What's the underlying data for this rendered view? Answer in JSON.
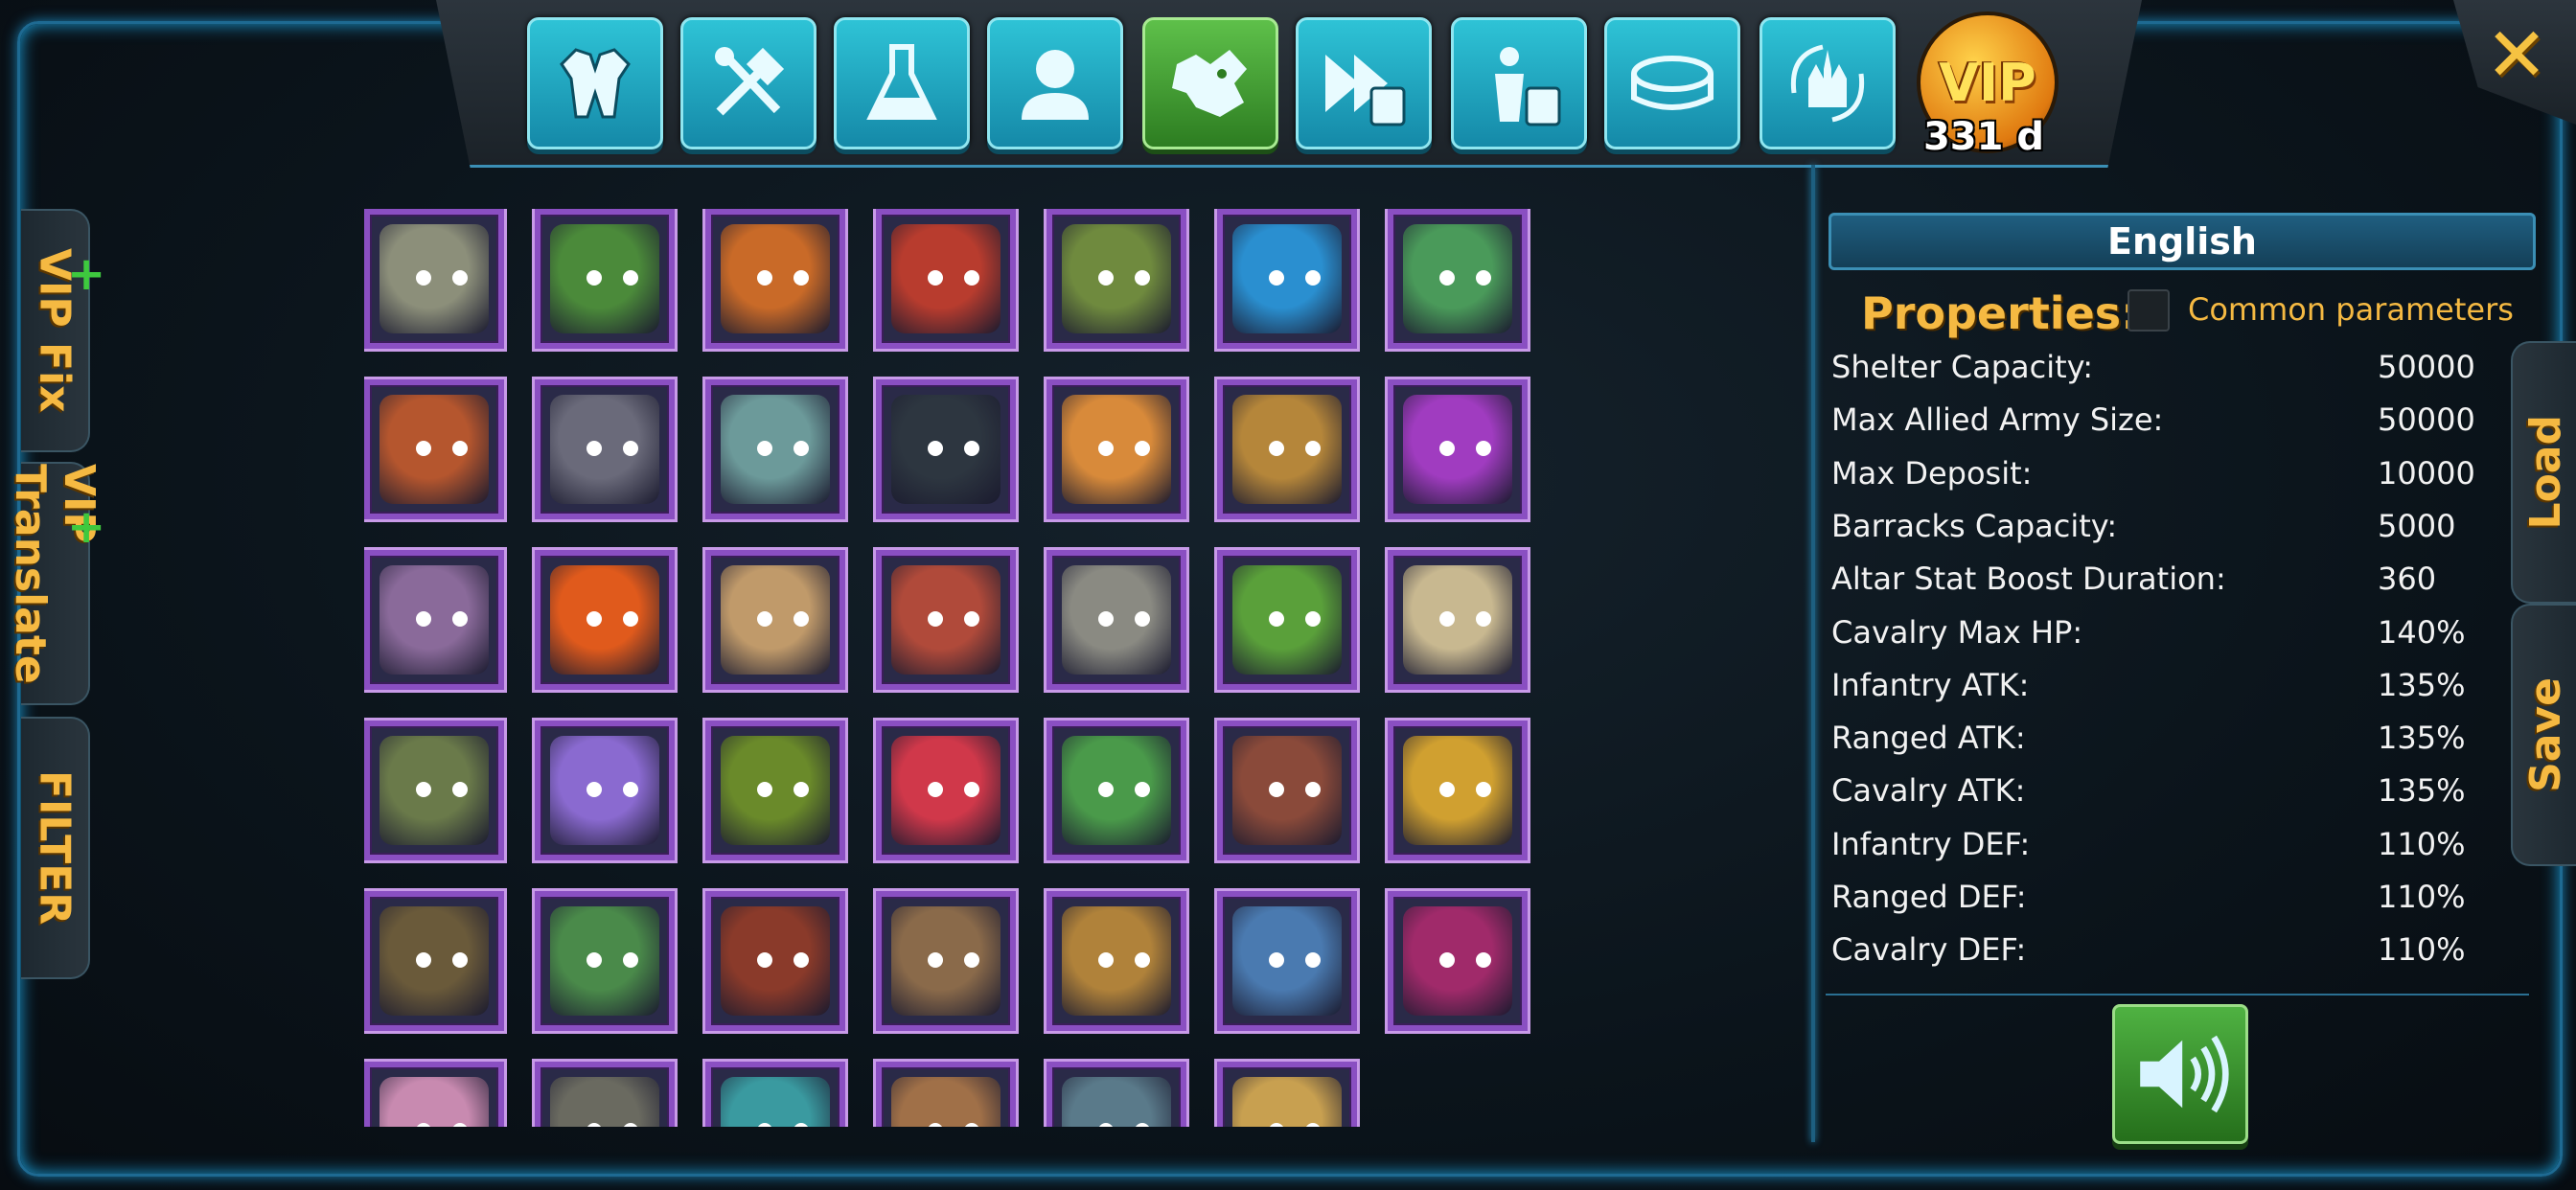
{
  "toolbar": {
    "buttons": [
      {
        "icon": "armor-icon",
        "active": false
      },
      {
        "icon": "tools-icon",
        "active": false
      },
      {
        "icon": "flask-icon",
        "active": false
      },
      {
        "icon": "person-icon",
        "active": false
      },
      {
        "icon": "beast-head-icon",
        "active": true
      },
      {
        "icon": "fast-forward-calculator-icon",
        "active": false
      },
      {
        "icon": "warrior-calculator-icon",
        "active": false
      },
      {
        "icon": "arena-icon",
        "active": false
      },
      {
        "icon": "castle-swap-icon",
        "active": false
      }
    ],
    "vip_label": "VIP",
    "vip_days": "331 d",
    "close_symbol": "✕"
  },
  "left_tabs": {
    "fix_label": "Fix",
    "fix_vip": "VIP",
    "translate_label": "Translate",
    "translate_vip": "VIP",
    "filter_label": "FILTER"
  },
  "right_tabs": {
    "load_label": "Load",
    "save_label": "Save"
  },
  "heroes": {
    "colors": [
      "#8c8f7a",
      "#4b8a3a",
      "#c96a28",
      "#b83c2e",
      "#6f8a3e",
      "#2a8fd0",
      "#4a9a5a",
      "#b5562e",
      "#6a6a7a",
      "#6c9a9a",
      "#2d3640",
      "#d88a3a",
      "#b5863a",
      "#a03cc0",
      "#8a6a9a",
      "#e05a1c",
      "#c09a6a",
      "#b04a3a",
      "#8a8a82",
      "#5aa03a",
      "#c8b890",
      "#6a7a4a",
      "#8a6ad0",
      "#6a8a2a",
      "#d0384a",
      "#4a9a4a",
      "#8a4a3a",
      "#d0a030",
      "#6a5a3a",
      "#4a8a4a",
      "#8a3a2a",
      "#8a6a4a",
      "#b0823a",
      "#4a7ab0",
      "#a02a6a",
      "#c88ab0",
      "#6a6a60",
      "#3a9aa0",
      "#a07048",
      "#5a7a8a",
      "#c8a050"
    ]
  },
  "panel": {
    "language": "English",
    "properties_title": "Properties:",
    "common_params_label": "Common parameters",
    "properties": [
      {
        "name": "Shelter Capacity:",
        "value": "50000"
      },
      {
        "name": "Max Allied Army Size:",
        "value": "50000"
      },
      {
        "name": "Max Deposit:",
        "value": "10000"
      },
      {
        "name": "Barracks Capacity:",
        "value": "5000"
      },
      {
        "name": "Altar Stat Boost Duration:",
        "value": "360"
      },
      {
        "name": "Cavalry Max HP:",
        "value": "140%"
      },
      {
        "name": "Infantry ATK:",
        "value": "135%"
      },
      {
        "name": "Ranged ATK:",
        "value": "135%"
      },
      {
        "name": "Cavalry ATK:",
        "value": "135%"
      },
      {
        "name": "Infantry DEF:",
        "value": "110%"
      },
      {
        "name": "Ranged DEF:",
        "value": "110%"
      },
      {
        "name": "Cavalry DEF:",
        "value": "110%"
      }
    ],
    "sound_icon": "speaker-icon"
  },
  "colors": {
    "accent_blue": "#2ec3d6",
    "active_green": "#5ec04a",
    "gold_text": "#f5b942",
    "tile_border": "#8a4fc2"
  }
}
